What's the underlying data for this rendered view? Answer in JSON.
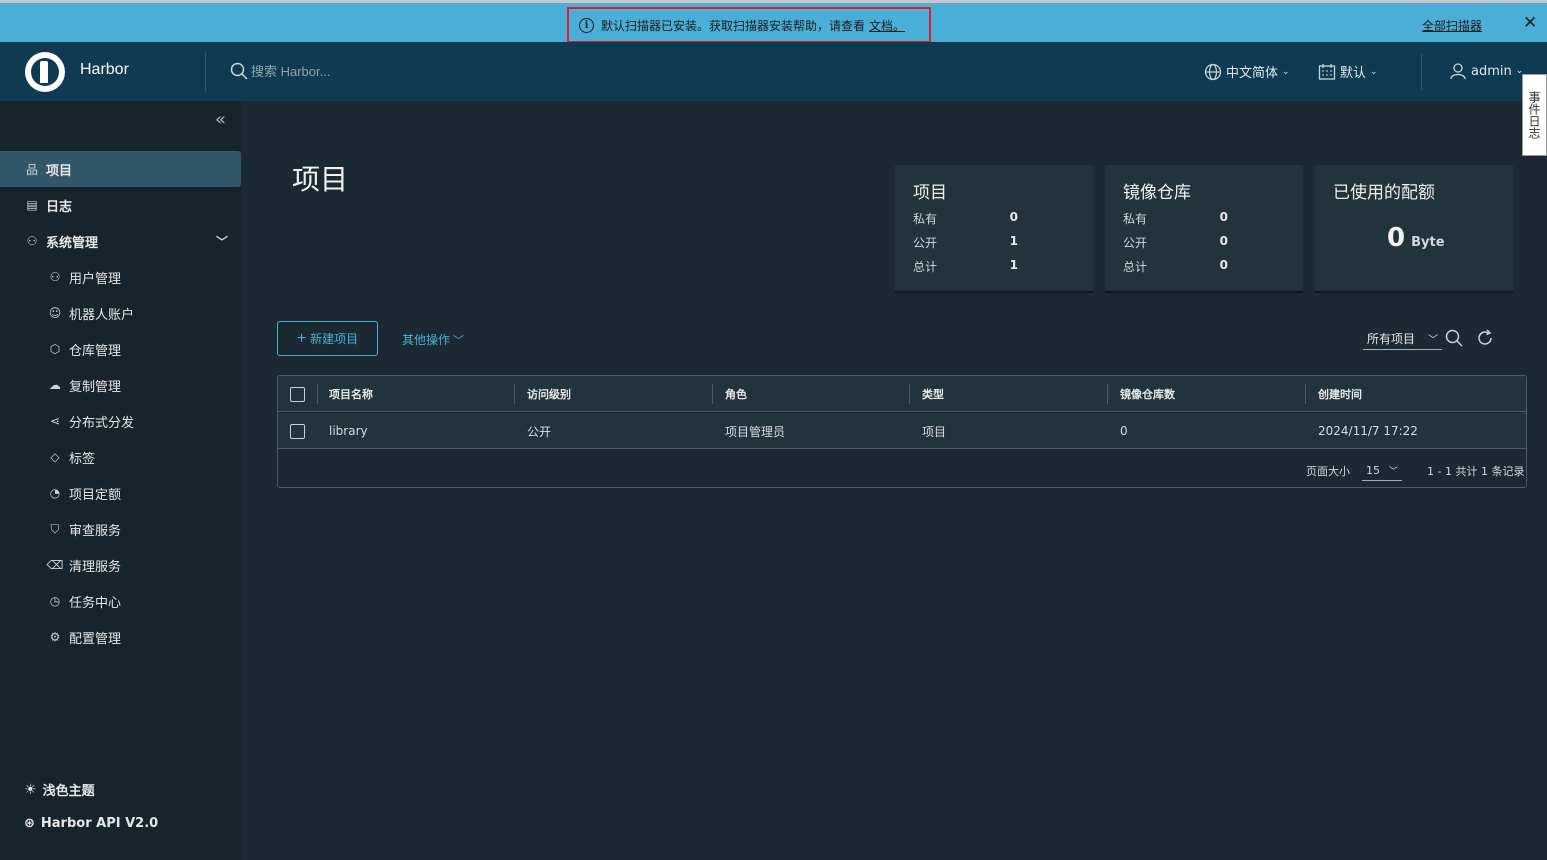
{
  "alert": {
    "message": "默认扫描器已安装。获取扫描器安装帮助，请查看",
    "doc_link": "文档。",
    "all_scanners": "全部扫描器",
    "close": "✕"
  },
  "header": {
    "brand": "Harbor",
    "search_placeholder": "搜索 Harbor...",
    "language": "中文简体",
    "datetime": "默认",
    "user": "admin",
    "event_log": "事件日志"
  },
  "sidebar": {
    "items": [
      {
        "label": "项目",
        "icon": "projects-icon"
      },
      {
        "label": "日志",
        "icon": "logs-icon"
      },
      {
        "label": "系统管理",
        "icon": "admin-icon"
      }
    ],
    "sub_items": [
      {
        "label": "用户管理",
        "icon": "users-icon"
      },
      {
        "label": "机器人账户",
        "icon": "robot-icon"
      },
      {
        "label": "仓库管理",
        "icon": "registry-icon"
      },
      {
        "label": "复制管理",
        "icon": "replication-icon"
      },
      {
        "label": "分布式分发",
        "icon": "share-icon"
      },
      {
        "label": "标签",
        "icon": "tag-icon"
      },
      {
        "label": "项目定额",
        "icon": "quota-icon"
      },
      {
        "label": "审查服务",
        "icon": "shield-icon"
      },
      {
        "label": "清理服务",
        "icon": "trash-icon"
      },
      {
        "label": "任务中心",
        "icon": "dashboard-icon"
      },
      {
        "label": "配置管理",
        "icon": "gear-icon"
      }
    ],
    "theme": "浅色主题",
    "api": "Harbor API V2.0"
  },
  "main": {
    "title": "项目",
    "cards": [
      {
        "title": "项目",
        "rows": [
          {
            "label": "私有",
            "value": "0"
          },
          {
            "label": "公开",
            "value": "1"
          },
          {
            "label": "总计",
            "value": "1"
          }
        ]
      },
      {
        "title": "镜像仓库",
        "rows": [
          {
            "label": "私有",
            "value": "0"
          },
          {
            "label": "公开",
            "value": "0"
          },
          {
            "label": "总计",
            "value": "0"
          }
        ]
      }
    ],
    "quota_card": {
      "title": "已使用的配额",
      "value": "0",
      "unit": "Byte"
    },
    "new_project": "新建项目",
    "other_actions": "其他操作",
    "filter": "所有项目",
    "table": {
      "headers": [
        "项目名称",
        "访问级别",
        "角色",
        "类型",
        "镜像仓库数",
        "创建时间"
      ],
      "rows": [
        {
          "name": "library",
          "access": "公开",
          "role": "项目管理员",
          "type": "项目",
          "repo_count": "0",
          "created": "2024/11/7 17:22"
        }
      ],
      "page_size_label": "页面大小",
      "page_size": "15",
      "page_info": "1 - 1 共计 1 条记录"
    }
  }
}
